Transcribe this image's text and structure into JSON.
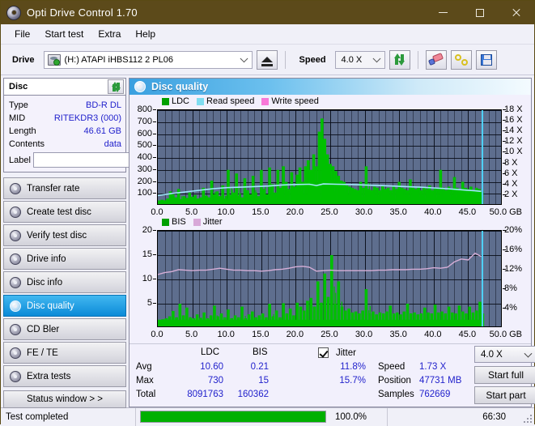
{
  "window": {
    "title": "Opti Drive Control 1.70",
    "icon": "disc-icon",
    "minimize": "minimize-icon",
    "maximize": "maximize-icon",
    "close": "close-icon"
  },
  "menu": {
    "items": [
      "File",
      "Start test",
      "Extra",
      "Help"
    ]
  },
  "toolbar": {
    "drive_label": "Drive",
    "drive_value": "(H:)  ATAPI iHBS112  2 PL06",
    "eject_icon": "eject-icon",
    "speed_label": "Speed",
    "speed_value": "4.0 X",
    "refresh_icon": "refresh-icon",
    "erase_icon": "eraser-icon",
    "chain_icon": "chain-icon",
    "save_icon": "save-icon"
  },
  "disc_panel": {
    "title": "Disc",
    "refresh_icon": "refresh-icon",
    "rows": [
      {
        "key": "Type",
        "value": "BD-R DL"
      },
      {
        "key": "MID",
        "value": "RITEKDR3 (000)"
      },
      {
        "key": "Length",
        "value": "46.61 GB"
      },
      {
        "key": "Contents",
        "value": "data"
      }
    ],
    "label_key": "Label",
    "label_value": "",
    "label_placeholder": "",
    "label_button_icon": "cd-icon"
  },
  "nav": {
    "items": [
      {
        "label": "Transfer rate",
        "active": false
      },
      {
        "label": "Create test disc",
        "active": false
      },
      {
        "label": "Verify test disc",
        "active": false
      },
      {
        "label": "Drive info",
        "active": false
      },
      {
        "label": "Disc info",
        "active": false
      },
      {
        "label": "Disc quality",
        "active": true
      },
      {
        "label": "CD Bler",
        "active": false
      },
      {
        "label": "FE / TE",
        "active": false
      },
      {
        "label": "Extra tests",
        "active": false
      }
    ],
    "status_window": "Status window > >"
  },
  "main": {
    "title": "Disc quality",
    "title_icon": "disc-quality-icon"
  },
  "chart_data": [
    {
      "type": "line",
      "name": "ldc-chart",
      "title": "",
      "xlabel": "GB",
      "ylabel": "",
      "xlim": [
        0,
        50
      ],
      "ylim": [
        0,
        800
      ],
      "y2lim": [
        0,
        18
      ],
      "grid": true,
      "legend_position": "top-left",
      "legend": [
        {
          "label": "LDC",
          "color": "#00a000"
        },
        {
          "label": "Read speed",
          "color": "#7fdcf0"
        },
        {
          "label": "Write speed",
          "color": "#f878d8"
        }
      ],
      "xticks": [
        "0.0",
        "5.0",
        "10.0",
        "15.0",
        "20.0",
        "25.0",
        "30.0",
        "35.0",
        "40.0",
        "45.0",
        "50.0"
      ],
      "yticks": [
        "100",
        "200",
        "300",
        "400",
        "500",
        "600",
        "700",
        "800"
      ],
      "y2ticks": [
        "2 X",
        "4 X",
        "6 X",
        "8 X",
        "10 X",
        "12 X",
        "14 X",
        "16 X",
        "18 X"
      ],
      "x_unit": "GB",
      "cursor_x": 46.9,
      "series": [
        {
          "name": "LDC",
          "color": "#00c000",
          "kind": "bars",
          "x": [
            0.0,
            0.4,
            0.8,
            1.2,
            1.6,
            2.0,
            2.4,
            2.8,
            3.2,
            3.6,
            4.0,
            4.4,
            4.8,
            5.2,
            5.6,
            6.0,
            6.4,
            6.8,
            7.2,
            7.6,
            8.0,
            8.4,
            8.8,
            9.2,
            9.6,
            10.0,
            10.4,
            10.8,
            11.2,
            11.6,
            12.0,
            12.4,
            12.8,
            13.2,
            13.6,
            14.0,
            14.4,
            14.8,
            15.2,
            15.6,
            16.0,
            16.4,
            16.8,
            17.2,
            17.6,
            18.0,
            18.4,
            18.8,
            19.2,
            19.6,
            20.0,
            20.4,
            20.8,
            21.2,
            21.6,
            22.0,
            22.4,
            22.8,
            23.2,
            23.6,
            24.0,
            24.4,
            24.8,
            25.2,
            25.6,
            26.0,
            26.4,
            26.8,
            27.2,
            27.6,
            28.0,
            28.4,
            28.8,
            29.2,
            29.6,
            30.0,
            30.4,
            30.8,
            31.2,
            31.6,
            32.0,
            32.4,
            32.8,
            33.2,
            33.6,
            34.0,
            34.4,
            34.8,
            35.2,
            35.6,
            36.0,
            36.4,
            36.8,
            37.2,
            37.6,
            38.0,
            38.4,
            38.8,
            39.2,
            39.6,
            40.0,
            40.4,
            40.8,
            41.2,
            41.6,
            42.0,
            42.4,
            42.8,
            43.2,
            43.6,
            44.0,
            44.4,
            44.8,
            45.2,
            45.6,
            46.0,
            46.4,
            46.8
          ],
          "values": [
            40,
            50,
            45,
            60,
            120,
            95,
            70,
            140,
            55,
            80,
            65,
            110,
            75,
            90,
            60,
            70,
            150,
            85,
            70,
            210,
            95,
            120,
            80,
            170,
            60,
            300,
            90,
            110,
            270,
            85,
            70,
            230,
            130,
            95,
            250,
            110,
            80,
            300,
            140,
            95,
            320,
            180,
            110,
            300,
            150,
            330,
            200,
            140,
            280,
            160,
            260,
            320,
            200,
            330,
            380,
            300,
            430,
            330,
            620,
            730,
            560,
            430,
            350,
            330,
            290,
            250,
            210,
            200,
            170,
            160,
            150,
            140,
            130,
            200,
            150,
            330,
            140,
            130,
            160,
            150,
            130,
            170,
            140,
            150,
            130,
            160,
            140,
            200,
            150,
            140,
            130,
            220,
            150,
            140,
            160,
            130,
            150,
            140,
            170,
            130,
            150,
            140,
            300,
            150,
            130,
            160,
            140,
            240,
            150,
            130,
            200,
            150,
            140,
            160,
            130,
            150,
            140,
            120
          ]
        },
        {
          "name": "Read speed",
          "color": "#9fe8fa",
          "kind": "line",
          "axis": "right",
          "x": [
            0.0,
            2.0,
            4.0,
            6.0,
            8.0,
            10.0,
            12.0,
            14.0,
            16.0,
            18.0,
            20.0,
            22.0,
            23.0,
            24.0,
            26.0,
            28.0,
            30.0,
            32.0,
            34.0,
            36.0,
            38.0,
            40.0,
            42.0,
            44.0,
            46.0,
            46.9
          ],
          "values": [
            1.9,
            2.3,
            2.6,
            2.9,
            3.2,
            3.4,
            3.5,
            3.6,
            3.7,
            3.9,
            4.0,
            4.05,
            3.8,
            4.1,
            4.05,
            4.0,
            3.9,
            3.8,
            3.7,
            3.6,
            3.5,
            3.35,
            3.2,
            3.0,
            2.8,
            2.7
          ]
        }
      ]
    },
    {
      "type": "line",
      "name": "bis-jitter-chart",
      "title": "",
      "xlabel": "GB",
      "ylabel": "",
      "xlim": [
        0,
        50
      ],
      "ylim": [
        0,
        20
      ],
      "y2lim": [
        0,
        20
      ],
      "grid": true,
      "legend_position": "top-left",
      "legend": [
        {
          "label": "BIS",
          "color": "#00a000"
        },
        {
          "label": "Jitter",
          "color": "#d8a8d8"
        }
      ],
      "xticks": [
        "0.0",
        "5.0",
        "10.0",
        "15.0",
        "20.0",
        "25.0",
        "30.0",
        "35.0",
        "40.0",
        "45.0",
        "50.0"
      ],
      "yticks": [
        "5",
        "10",
        "15",
        "20"
      ],
      "y2ticks": [
        "4%",
        "8%",
        "12%",
        "16%",
        "20%"
      ],
      "x_unit": "GB",
      "cursor_x": 46.9,
      "series": [
        {
          "name": "BIS",
          "color": "#00c000",
          "kind": "bars",
          "x": [
            0.0,
            0.5,
            1.0,
            1.5,
            2.0,
            2.5,
            3.0,
            3.5,
            4.0,
            4.5,
            5.0,
            5.5,
            6.0,
            6.5,
            7.0,
            7.5,
            8.0,
            8.5,
            9.0,
            9.5,
            10.0,
            10.5,
            11.0,
            11.5,
            12.0,
            12.5,
            13.0,
            13.5,
            14.0,
            14.5,
            15.0,
            15.5,
            16.0,
            16.5,
            17.0,
            17.5,
            18.0,
            18.5,
            19.0,
            19.5,
            20.0,
            20.5,
            21.0,
            21.5,
            22.0,
            22.5,
            23.0,
            23.5,
            24.0,
            24.5,
            25.0,
            25.5,
            26.0,
            26.5,
            27.0,
            27.5,
            28.0,
            28.5,
            29.0,
            29.5,
            30.0,
            30.5,
            31.0,
            31.5,
            32.0,
            32.5,
            33.0,
            33.5,
            34.0,
            34.5,
            35.0,
            35.5,
            36.0,
            36.5,
            37.0,
            37.5,
            38.0,
            38.5,
            39.0,
            39.5,
            40.0,
            40.5,
            41.0,
            41.5,
            42.0,
            42.5,
            43.0,
            43.5,
            44.0,
            44.5,
            45.0,
            45.5,
            46.0,
            46.5,
            46.9
          ],
          "values": [
            1.6,
            1.8,
            2.0,
            2.4,
            3.5,
            2.2,
            5.0,
            2.6,
            4.2,
            2.2,
            2.0,
            2.8,
            2.1,
            3.2,
            2.0,
            2.6,
            4.6,
            2.4,
            3.0,
            2.2,
            3.8,
            2.0,
            2.6,
            2.2,
            4.4,
            2.0,
            2.8,
            3.4,
            2.2,
            2.6,
            3.0,
            2.2,
            5.0,
            2.4,
            3.6,
            2.2,
            5.1,
            3.0,
            4.0,
            2.6,
            5.2,
            4.4,
            3.6,
            5.6,
            6.2,
            4.4,
            9.6,
            5.2,
            11.2,
            6.4,
            15.0,
            5.0,
            9.6,
            4.4,
            3.6,
            4.0,
            3.2,
            3.4,
            3.0,
            3.6,
            8.0,
            3.0,
            3.4,
            2.8,
            3.2,
            3.0,
            3.4,
            4.6,
            3.0,
            3.2,
            2.8,
            3.4,
            5.0,
            3.0,
            3.2,
            2.8,
            3.0,
            4.2,
            3.2,
            3.0,
            4.8,
            3.2,
            3.4,
            3.0,
            4.4,
            3.2,
            3.0,
            4.6,
            3.4,
            3.0,
            4.4,
            3.2,
            3.6,
            5.4,
            3.0
          ]
        },
        {
          "name": "Jitter",
          "color": "#d6aed6",
          "kind": "line",
          "axis": "right",
          "x": [
            0.0,
            1.0,
            2.0,
            3.0,
            4.0,
            5.0,
            6.0,
            7.0,
            8.0,
            9.0,
            10.0,
            11.0,
            12.0,
            13.0,
            14.0,
            15.0,
            16.0,
            17.0,
            18.0,
            19.0,
            20.0,
            21.0,
            22.0,
            23.0,
            24.0,
            25.0,
            26.0,
            27.0,
            28.0,
            29.0,
            30.0,
            31.0,
            32.0,
            33.0,
            34.0,
            35.0,
            36.0,
            37.0,
            38.0,
            39.0,
            40.0,
            41.0,
            42.0,
            43.0,
            44.0,
            45.0,
            46.0,
            46.9
          ],
          "values": [
            11.0,
            11.4,
            11.6,
            12.0,
            11.9,
            11.8,
            11.9,
            11.9,
            12.1,
            12.3,
            12.1,
            11.9,
            11.9,
            11.8,
            11.8,
            11.7,
            11.8,
            12.0,
            12.1,
            12.3,
            12.6,
            12.7,
            12.5,
            11.7,
            11.8,
            11.9,
            11.8,
            11.8,
            11.8,
            11.8,
            11.8,
            11.8,
            11.9,
            11.9,
            12.0,
            12.0,
            12.0,
            12.1,
            12.1,
            12.2,
            12.4,
            12.3,
            12.5,
            13.6,
            14.2,
            14.0,
            15.4,
            14.7
          ]
        }
      ]
    }
  ],
  "stats": {
    "col_headers": [
      "LDC",
      "BIS"
    ],
    "rows": [
      {
        "key": "Avg",
        "ldc": "10.60",
        "bis": "0.21"
      },
      {
        "key": "Max",
        "ldc": "730",
        "bis": "15"
      },
      {
        "key": "Total",
        "ldc": "8091763",
        "bis": "160362"
      }
    ],
    "jitter_label": "Jitter",
    "jitter_checked": true,
    "jitter_avg": "11.8%",
    "jitter_max": "15.7%",
    "speed_label": "Speed",
    "speed_value": "1.73 X",
    "position_label": "Position",
    "position_value": "47731 MB",
    "samples_label": "Samples",
    "samples_value": "762669",
    "speed_select": "4.0 X",
    "start_full": "Start full",
    "start_part": "Start part"
  },
  "statusbar": {
    "message": "Test completed",
    "progress_percent": 100,
    "progress_text": "100.0%",
    "elapsed": "66:30"
  },
  "colors": {
    "title_bar": "#5c4a1a",
    "accent": "#0b8ad8",
    "plot_bg": "#5e6e8e",
    "value_text": "#2222cc",
    "ldc_green": "#00c000",
    "read_speed": "#9fe8fa",
    "write_speed": "#f878d8",
    "jitter": "#d6aed6",
    "progress": "#00b000"
  }
}
